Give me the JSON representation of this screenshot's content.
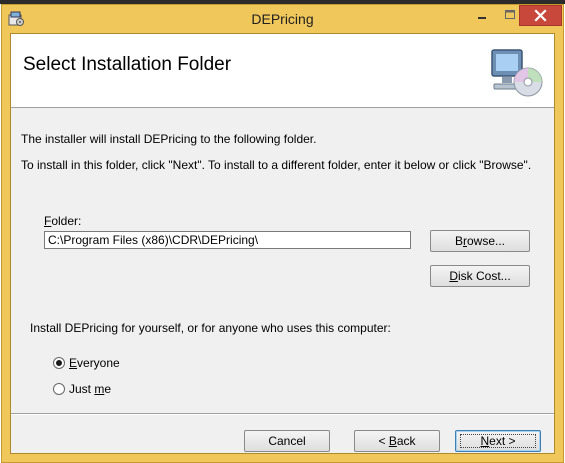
{
  "window": {
    "title": "DEPricing",
    "minimize_glyph": "–",
    "maximize_glyph": "□",
    "close_glyph": "✕"
  },
  "banner": {
    "title": "Select Installation Folder",
    "icon": "computer-cd-icon"
  },
  "content": {
    "line1": "The installer will install DEPricing to the following folder.",
    "line2": "To install in this folder, click \"Next\". To install to a different folder, enter it below or click \"Browse\".",
    "folder_label_first": "F",
    "folder_label_rest": "older:",
    "folder_value": "C:\\Program Files (x86)\\CDR\\DEPricing\\",
    "install_for": "Install DEPricing for yourself, or for anyone who uses this computer:"
  },
  "buttons": {
    "browse_pre": "B",
    "browse_u": "r",
    "browse_post": "owse...",
    "disk_u": "D",
    "disk_post": "isk Cost...",
    "cancel": "Cancel",
    "back_pre": "< ",
    "back_u": "B",
    "back_post": "ack",
    "next_u": "N",
    "next_post": "ext >"
  },
  "radios": {
    "everyone_u": "E",
    "everyone_post": "veryone",
    "justme_pre": "Just ",
    "justme_u": "m",
    "justme_post": "e",
    "selected": "everyone"
  },
  "colors": {
    "title_bar": "#f0c75a",
    "close_button": "#c9483c",
    "client_bg": "#f0f0f0"
  }
}
